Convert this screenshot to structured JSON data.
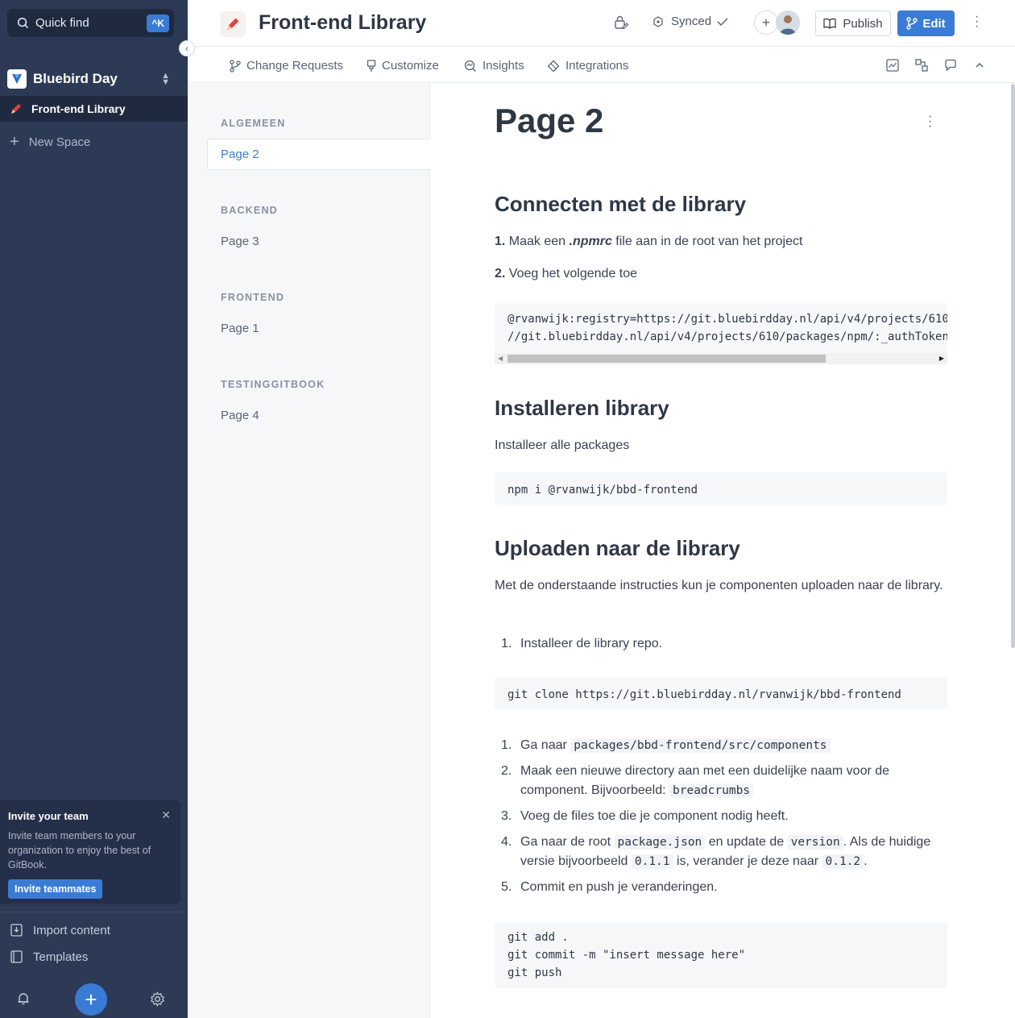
{
  "sidebar": {
    "quick_find": "Quick find",
    "shortcut": "^K",
    "org_name": "Bluebird Day",
    "active_space": "Front-end Library",
    "new_space": "New Space",
    "invite": {
      "title": "Invite your team",
      "description": "Invite team members to your organization to enjoy the best of GitBook.",
      "button": "Invite teammates"
    },
    "import_content": "Import content",
    "templates": "Templates"
  },
  "header": {
    "space_title": "Front-end Library",
    "sync_status": "Synced",
    "publish": "Publish",
    "edit": "Edit"
  },
  "tabs": [
    {
      "label": "Change Requests",
      "icon": "branch-icon"
    },
    {
      "label": "Customize",
      "icon": "brush-icon"
    },
    {
      "label": "Insights",
      "icon": "insights-icon"
    },
    {
      "label": "Integrations",
      "icon": "puzzle-icon"
    }
  ],
  "nav": {
    "groups": [
      {
        "title": "ALGEMEEN",
        "pages": [
          "Page 2"
        ]
      },
      {
        "title": "BACKEND",
        "pages": [
          "Page 3"
        ]
      },
      {
        "title": "FRONTEND",
        "pages": [
          "Page 1"
        ]
      },
      {
        "title": "TESTINGGITBOOK",
        "pages": [
          "Page 4"
        ]
      }
    ],
    "active_page": "Page 2"
  },
  "page": {
    "title": "Page 2",
    "sections": {
      "connect": {
        "heading": "Connecten met de library",
        "step1_num": "1.",
        "step1_pre": "Maak een ",
        "step1_em": ".npmrc",
        "step1_post": " file aan in de root van het project",
        "step2_num": "2.",
        "step2_text": " Voeg het volgende toe",
        "code": "@rvanwijk:registry=https://git.bluebirdday.nl/api/v4/projects/610\n//git.bluebirdday.nl/api/v4/projects/610/packages/npm/:_authToken"
      },
      "install": {
        "heading": "Installeren library",
        "text": "Installeer alle packages",
        "code": "npm i @rvanwijk/bbd-frontend"
      },
      "upload": {
        "heading": "Uploaden naar de library",
        "intro": "Met de onderstaande instructies kun je componenten uploaden naar de library.",
        "list1": [
          {
            "num": "1.",
            "text": "Installeer de library repo."
          }
        ],
        "code1": "git clone https://git.bluebirdday.nl/rvanwijk/bbd-frontend",
        "list2": {
          "i1_num": "1.",
          "i1_pre": "Ga naar ",
          "i1_code": "packages/bbd-frontend/src/components",
          "i2_num": "2.",
          "i2_pre": "Maak een nieuwe directory aan met een duidelijke naam voor de component. Bijvoorbeeld: ",
          "i2_code": "breadcrumbs",
          "i3_num": "3.",
          "i3_text": "Voeg de files toe die je component nodig heeft.",
          "i4_num": "4.",
          "i4_a": "Ga naar de root ",
          "i4_code1": "package.json",
          "i4_b": " en update de ",
          "i4_code2": "version",
          "i4_c": ". Als de huidige versie bijvoorbeeld ",
          "i4_code3": "0.1.1",
          "i4_d": " is, verander je deze naar ",
          "i4_code4": "0.1.2",
          "i4_e": ".",
          "i5_num": "5.",
          "i5_text": "Commit en push je veranderingen."
        },
        "code2": "git add .\ngit commit -m \"insert message here\"\ngit push"
      }
    }
  },
  "colors": {
    "sidebar_bg": "#2c3a55",
    "accent": "#3a7bd5"
  }
}
